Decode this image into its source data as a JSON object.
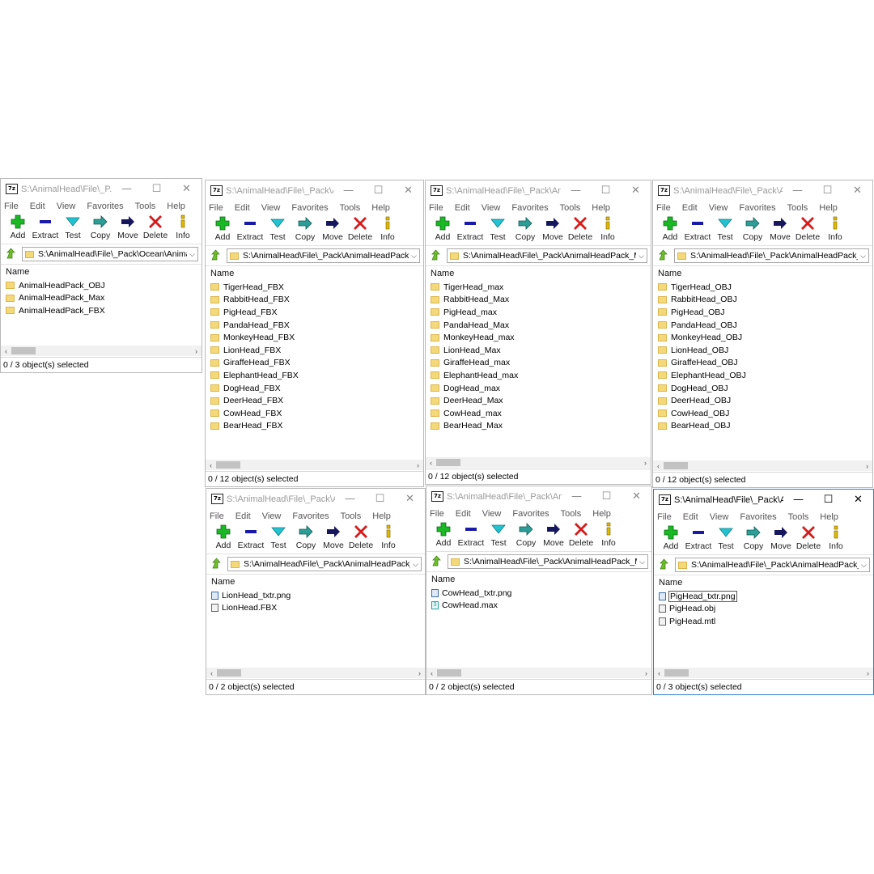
{
  "menu": [
    "File",
    "Edit",
    "View",
    "Favorites",
    "Tools",
    "Help"
  ],
  "toolbar": [
    "Add",
    "Extract",
    "Test",
    "Copy",
    "Move",
    "Delete",
    "Info"
  ],
  "list_header": "Name",
  "colors": {
    "add": "#19b824",
    "extract": "#1a1aa8",
    "test": "#21c3d0",
    "copy": "#2c9e96",
    "move": "#17175e",
    "delete": "#d51c1c",
    "info": "#e0b800",
    "folder": "#f4d97a"
  },
  "windows": [
    {
      "title": "S:\\AnimalHead\\File\\_P...",
      "path": "S:\\AnimalHead\\File\\_Pack\\Ocean\\AnimalH",
      "items": [
        {
          "name": "AnimalHeadPack_OBJ",
          "icon": "folder-icon"
        },
        {
          "name": "AnimalHeadPack_Max",
          "icon": "folder-icon"
        },
        {
          "name": "AnimalHeadPack_FBX",
          "icon": "folder-icon"
        }
      ],
      "status": "0 / 3 object(s) selected"
    },
    {
      "title": "S:\\AnimalHead\\File\\_Pack\\A...",
      "path": "S:\\AnimalHead\\File\\_Pack\\AnimalHeadPack_FBX",
      "items": [
        {
          "name": "TigerHead_FBX",
          "icon": "folder-icon"
        },
        {
          "name": "RabbitHead_FBX",
          "icon": "folder-icon"
        },
        {
          "name": "PigHead_FBX",
          "icon": "folder-icon"
        },
        {
          "name": "PandaHead_FBX",
          "icon": "folder-icon"
        },
        {
          "name": "MonkeyHead_FBX",
          "icon": "folder-icon"
        },
        {
          "name": "LionHead_FBX",
          "icon": "folder-icon"
        },
        {
          "name": "GiraffeHead_FBX",
          "icon": "folder-icon"
        },
        {
          "name": "ElephantHead_FBX",
          "icon": "folder-icon"
        },
        {
          "name": "DogHead_FBX",
          "icon": "folder-icon"
        },
        {
          "name": "DeerHead_FBX",
          "icon": "folder-icon"
        },
        {
          "name": "CowHead_FBX",
          "icon": "folder-icon"
        },
        {
          "name": "BearHead_FBX",
          "icon": "folder-icon"
        }
      ],
      "status": "0 / 12 object(s) selected"
    },
    {
      "title": "S:\\AnimalHead\\File\\_Pack\\Ani...",
      "path": "S:\\AnimalHead\\File\\_Pack\\AnimalHeadPack_Max.",
      "items": [
        {
          "name": "TigerHead_max",
          "icon": "folder-icon"
        },
        {
          "name": "RabbitHead_Max",
          "icon": "folder-icon"
        },
        {
          "name": "PigHead_max",
          "icon": "folder-icon"
        },
        {
          "name": "PandaHead_Max",
          "icon": "folder-icon"
        },
        {
          "name": "MonkeyHead_max",
          "icon": "folder-icon"
        },
        {
          "name": "LionHead_Max",
          "icon": "folder-icon"
        },
        {
          "name": "GiraffeHead_max",
          "icon": "folder-icon"
        },
        {
          "name": "ElephantHead_max",
          "icon": "folder-icon"
        },
        {
          "name": "DogHead_max",
          "icon": "folder-icon"
        },
        {
          "name": "DeerHead_Max",
          "icon": "folder-icon"
        },
        {
          "name": "CowHead_max",
          "icon": "folder-icon"
        },
        {
          "name": "BearHead_Max",
          "icon": "folder-icon"
        }
      ],
      "status": "0 / 12 object(s) selected"
    },
    {
      "title": "S:\\AnimalHead\\File\\_Pack\\A...",
      "path": "S:\\AnimalHead\\File\\_Pack\\AnimalHeadPack_OB",
      "items": [
        {
          "name": "TigerHead_OBJ",
          "icon": "folder-icon"
        },
        {
          "name": "RabbitHead_OBJ",
          "icon": "folder-icon"
        },
        {
          "name": "PigHead_OBJ",
          "icon": "folder-icon"
        },
        {
          "name": "PandaHead_OBJ",
          "icon": "folder-icon"
        },
        {
          "name": "MonkeyHead_OBJ",
          "icon": "folder-icon"
        },
        {
          "name": "LionHead_OBJ",
          "icon": "folder-icon"
        },
        {
          "name": "GiraffeHead_OBJ",
          "icon": "folder-icon"
        },
        {
          "name": "ElephantHead_OBJ",
          "icon": "folder-icon"
        },
        {
          "name": "DogHead_OBJ",
          "icon": "folder-icon"
        },
        {
          "name": "DeerHead_OBJ",
          "icon": "folder-icon"
        },
        {
          "name": "CowHead_OBJ",
          "icon": "folder-icon"
        },
        {
          "name": "BearHead_OBJ",
          "icon": "folder-icon"
        }
      ],
      "status": "0 / 12 object(s) selected"
    },
    {
      "title": "S:\\AnimalHead\\File\\_Pack\\A...",
      "path": "S:\\AnimalHead\\File\\_Pack\\AnimalHeadPack_FB",
      "items": [
        {
          "name": "LionHead_txtr.png",
          "icon": "image-file-icon"
        },
        {
          "name": "LionHead.FBX",
          "icon": "fbx-file-icon"
        }
      ],
      "status": "0 / 2 object(s) selected"
    },
    {
      "title": "S:\\AnimalHead\\File\\_Pack\\Ani...",
      "path": "S:\\AnimalHead\\File\\_Pack\\AnimalHeadPack_Max.:",
      "items": [
        {
          "name": "CowHead_txtr.png",
          "icon": "image-file-icon"
        },
        {
          "name": "CowHead.max",
          "icon": "max-file-icon"
        }
      ],
      "status": "0 / 2 object(s) selected"
    },
    {
      "title": "S:\\AnimalHead\\File\\_Pack\\A...",
      "path": "S:\\AnimalHead\\File\\_Pack\\AnimalHeadPack_OB",
      "items": [
        {
          "name": "PigHead_txtr.png",
          "icon": "image-file-icon",
          "focused": true
        },
        {
          "name": "PigHead.obj",
          "icon": "obj-file-icon"
        },
        {
          "name": "PigHead.mtl",
          "icon": "mtl-file-icon"
        }
      ],
      "status": "0 / 3 object(s) selected"
    }
  ]
}
